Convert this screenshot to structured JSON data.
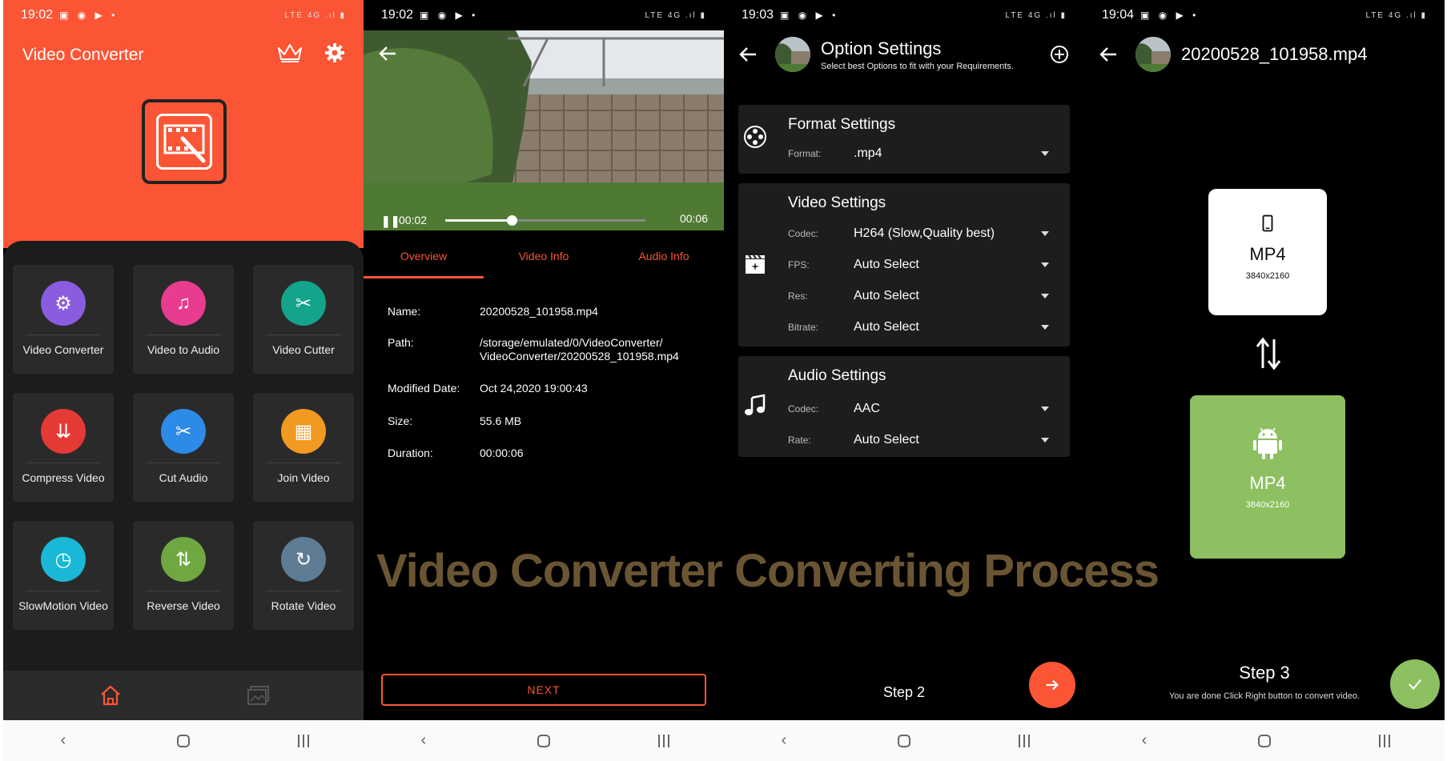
{
  "watermark": "Video Converter Converting Process",
  "navbar": {
    "back": "‹"
  },
  "screen1": {
    "time": "19:02",
    "app_title": "Video Converter",
    "tools": [
      {
        "label": "Video Converter",
        "color": "#8a5ce0",
        "glyph": "⚙"
      },
      {
        "label": "Video to Audio",
        "color": "#e83c8f",
        "glyph": "♫"
      },
      {
        "label": "Video Cutter",
        "color": "#14a38b",
        "glyph": "✂"
      },
      {
        "label": "Compress Video",
        "color": "#e53935",
        "glyph": "⇊"
      },
      {
        "label": "Cut Audio",
        "color": "#2d8be8",
        "glyph": "✂"
      },
      {
        "label": "Join Video",
        "color": "#f29a1f",
        "glyph": "▦"
      },
      {
        "label": "SlowMotion Video",
        "color": "#19b8d6",
        "glyph": "◷"
      },
      {
        "label": "Reverse Video",
        "color": "#6fa840",
        "glyph": "⇅"
      },
      {
        "label": "Rotate Video",
        "color": "#5e7c93",
        "glyph": "↻"
      }
    ]
  },
  "screen2": {
    "time": "19:02",
    "player": {
      "current": "00:02",
      "duration": "00:06",
      "progress": 0.33
    },
    "tabs": [
      "Overview",
      "Video Info",
      "Audio Info"
    ],
    "info": [
      {
        "key": "Name:",
        "value": "20200528_101958.mp4"
      },
      {
        "key": "Path:",
        "value": "/storage/emulated/0/VideoConverter/ VideoConverter/20200528_101958.mp4"
      },
      {
        "key": "Modified Date:",
        "value": "Oct 24,2020 19:00:43"
      },
      {
        "key": "Size:",
        "value": "55.6 MB"
      },
      {
        "key": "Duration:",
        "value": "00:00:06"
      }
    ],
    "next_label": "NEXT"
  },
  "screen3": {
    "time": "19:03",
    "title": "Option Settings",
    "subtitle": "Select best Options to fit with your Requirements.",
    "format": {
      "title": "Format Settings",
      "label": "Format:",
      "value": ".mp4"
    },
    "video": {
      "title": "Video Settings",
      "options": [
        {
          "label": "Codec:",
          "value": "H264 (Slow,Quality best)"
        },
        {
          "label": "FPS:",
          "value": "Auto Select"
        },
        {
          "label": "Res:",
          "value": "Auto Select"
        },
        {
          "label": "Bitrate:",
          "value": "Auto Select"
        }
      ]
    },
    "audio": {
      "title": "Audio Settings",
      "options": [
        {
          "label": "Codec:",
          "value": "AAC"
        },
        {
          "label": "Rate:",
          "value": "Auto Select"
        }
      ]
    },
    "step": "Step 2"
  },
  "screen4": {
    "time": "19:04",
    "title": "20200528_101958.mp4",
    "source": {
      "format": "MP4",
      "resolution": "3840x2160"
    },
    "target": {
      "format": "MP4",
      "resolution": "3840x2160"
    },
    "step": "Step 3",
    "step_hint": "You are done Click Right button to convert video."
  }
}
